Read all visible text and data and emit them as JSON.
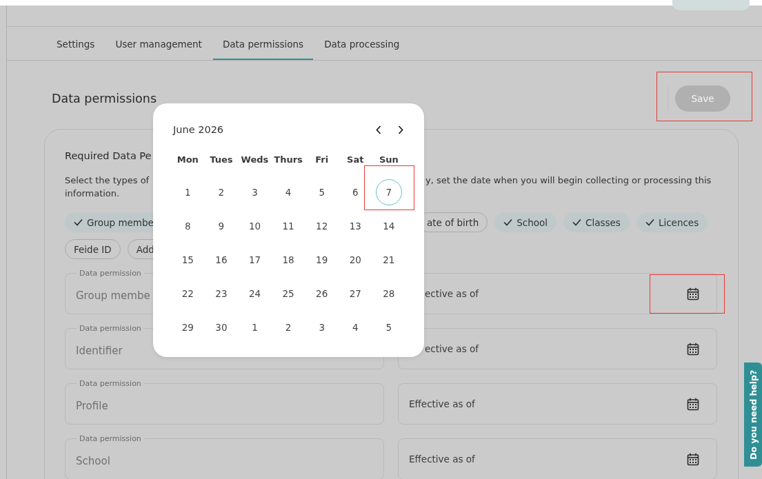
{
  "tabs": [
    {
      "label": "Settings",
      "selected": false
    },
    {
      "label": "User management",
      "selected": false
    },
    {
      "label": "Data permissions",
      "selected": true
    },
    {
      "label": "Data processing",
      "selected": false
    }
  ],
  "page_title": "Data permissions",
  "save_button": {
    "label": "Save",
    "disabled": true
  },
  "card": {
    "title": "Required Data Pe",
    "description": [
      {
        "left": "Select the types of",
        "right": "y, set the date when you will begin collecting or processing this"
      },
      {
        "left": "information."
      }
    ],
    "chip_rows": [
      {
        "left": [
          {
            "label": "Group membe",
            "selected": true
          }
        ],
        "right": [
          {
            "label": "ate of birth",
            "selected": false
          },
          {
            "label": "School",
            "selected": true
          },
          {
            "label": "Classes",
            "selected": true
          },
          {
            "label": "Licences",
            "selected": true
          }
        ]
      },
      {
        "left": [
          {
            "label": "Feide ID",
            "selected": false
          },
          {
            "label": "Add",
            "selected": false
          }
        ]
      }
    ],
    "fields": [
      {
        "label": "Data permission",
        "value": "Group membe",
        "date_placeholder": "ective as of",
        "covered": true
      },
      {
        "label": "Data permission",
        "value": "Identifier",
        "date_placeholder": "ective as of",
        "covered": true
      },
      {
        "label": "Data permission",
        "value": "Profile",
        "date_placeholder": "Effective as of",
        "covered": false
      },
      {
        "label": "Data permission",
        "value": "School",
        "date_placeholder": "Effective as of",
        "covered": false
      }
    ]
  },
  "calendar": {
    "month": "June 2026",
    "weekdays": [
      "Mon",
      "Tues",
      "Weds",
      "Thurs",
      "Fri",
      "Sat",
      "Sun"
    ],
    "weeks": [
      [
        {
          "day": "1",
          "selected": false
        },
        {
          "day": "2",
          "selected": false
        },
        {
          "day": "3",
          "selected": false
        },
        {
          "day": "4",
          "selected": false
        },
        {
          "day": "5",
          "selected": false
        },
        {
          "day": "6",
          "selected": false
        },
        {
          "day": "7",
          "selected": true
        }
      ],
      [
        {
          "day": "8",
          "selected": false
        },
        {
          "day": "9",
          "selected": false
        },
        {
          "day": "10",
          "selected": false
        },
        {
          "day": "11",
          "selected": false
        },
        {
          "day": "12",
          "selected": false
        },
        {
          "day": "13",
          "selected": false
        },
        {
          "day": "14",
          "selected": false
        }
      ],
      [
        {
          "day": "15",
          "selected": false
        },
        {
          "day": "16",
          "selected": false
        },
        {
          "day": "17",
          "selected": false
        },
        {
          "day": "18",
          "selected": false
        },
        {
          "day": "19",
          "selected": false
        },
        {
          "day": "20",
          "selected": false
        },
        {
          "day": "21",
          "selected": false
        }
      ],
      [
        {
          "day": "22",
          "selected": false
        },
        {
          "day": "23",
          "selected": false
        },
        {
          "day": "24",
          "selected": false
        },
        {
          "day": "25",
          "selected": false
        },
        {
          "day": "26",
          "selected": false
        },
        {
          "day": "27",
          "selected": false
        },
        {
          "day": "28",
          "selected": false
        }
      ],
      [
        {
          "day": "29",
          "selected": false
        },
        {
          "day": "30",
          "selected": false
        },
        {
          "day": "1",
          "selected": false
        },
        {
          "day": "2",
          "selected": false
        },
        {
          "day": "3",
          "selected": false
        },
        {
          "day": "4",
          "selected": false
        },
        {
          "day": "5",
          "selected": false
        }
      ]
    ]
  },
  "help_tab": {
    "label": "Do you need help?"
  }
}
